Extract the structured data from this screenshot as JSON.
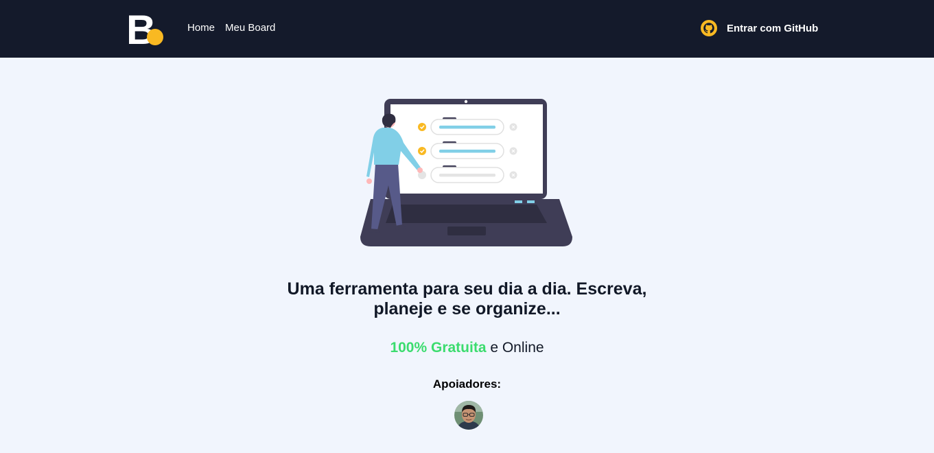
{
  "header": {
    "logo_letter": "B",
    "nav": [
      {
        "label": "Home"
      },
      {
        "label": "Meu Board"
      }
    ],
    "login_button": {
      "label": "Entrar com GitHub",
      "icon": "github-icon"
    }
  },
  "main": {
    "headline_line1": "Uma ferramenta para seu dia a dia. Escreva,",
    "headline_line2": "planeje e se organize...",
    "tagline_highlight": "100% Gratuita",
    "tagline_rest": " e Online",
    "supporters_title": "Apoiadores:"
  },
  "colors": {
    "header_bg": "#141a2b",
    "page_bg": "#f1f5fd",
    "accent_yellow": "#f9b922",
    "accent_green": "#3bdc6e"
  }
}
